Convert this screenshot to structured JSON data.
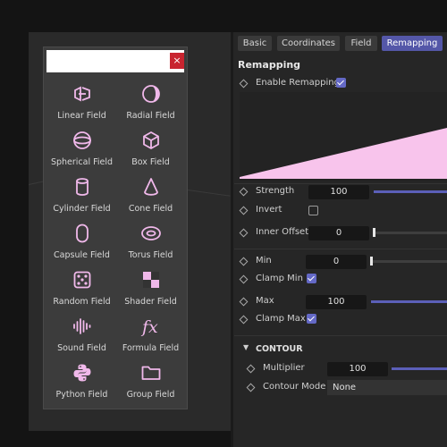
{
  "popup": {
    "search_placeholder": "",
    "close_label": "×",
    "items": [
      {
        "label": "Linear Field",
        "icon": "linear-field-icon"
      },
      {
        "label": "Radial Field",
        "icon": "radial-field-icon"
      },
      {
        "label": "Spherical Field",
        "icon": "spherical-field-icon"
      },
      {
        "label": "Box Field",
        "icon": "box-field-icon"
      },
      {
        "label": "Cylinder Field",
        "icon": "cylinder-field-icon"
      },
      {
        "label": "Cone Field",
        "icon": "cone-field-icon"
      },
      {
        "label": "Capsule Field",
        "icon": "capsule-field-icon"
      },
      {
        "label": "Torus Field",
        "icon": "torus-field-icon"
      },
      {
        "label": "Random Field",
        "icon": "random-field-icon"
      },
      {
        "label": "Shader Field",
        "icon": "shader-field-icon"
      },
      {
        "label": "Sound Field",
        "icon": "sound-field-icon"
      },
      {
        "label": "Formula Field",
        "icon": "formula-field-icon"
      },
      {
        "label": "Python Field",
        "icon": "python-field-icon"
      },
      {
        "label": "Group Field",
        "icon": "group-field-icon"
      }
    ]
  },
  "tabs": [
    {
      "label": "Basic",
      "active": false
    },
    {
      "label": "Coordinates",
      "active": false
    },
    {
      "label": "Field",
      "active": false
    },
    {
      "label": "Remapping",
      "active": true
    }
  ],
  "remapping": {
    "header": "Remapping",
    "enable_label": "Enable Remapping",
    "enable_checked": true,
    "strength_label": "Strength",
    "strength_value": "100",
    "invert_label": "Invert",
    "invert_checked": false,
    "inner_offset_label": "Inner Offset",
    "inner_offset_value": "0",
    "min_label": "Min",
    "min_value": "0",
    "clamp_min_label": "Clamp Min",
    "clamp_min_checked": true,
    "max_label": "Max",
    "max_value": "100",
    "clamp_max_label": "Clamp Max",
    "clamp_max_checked": true
  },
  "contour": {
    "header": "CONTOUR",
    "multiplier_label": "Multiplier",
    "multiplier_value": "100",
    "mode_label": "Contour Mode",
    "mode_value": "None"
  },
  "colors": {
    "accent": "#5457a8",
    "icon": "#f0b8ea",
    "curve_fill": "#f8c4ec",
    "close": "#c8242f"
  }
}
